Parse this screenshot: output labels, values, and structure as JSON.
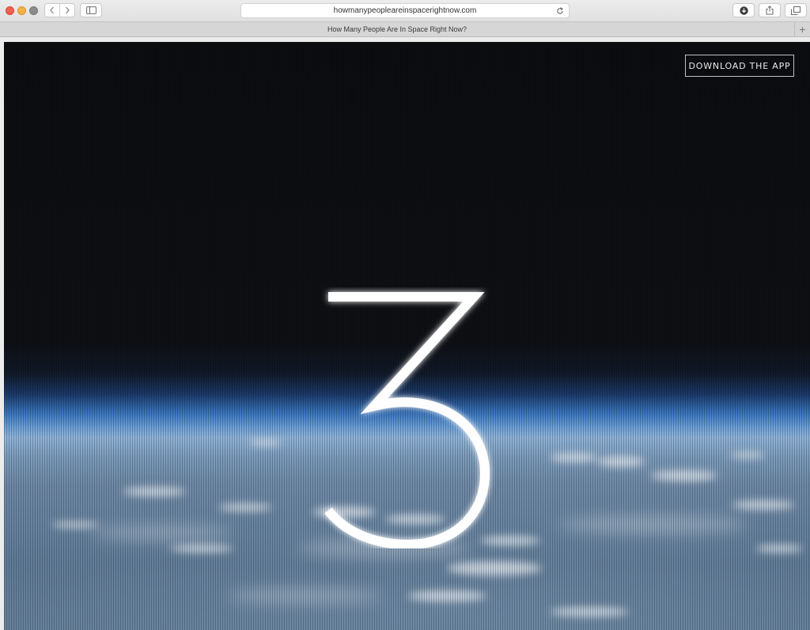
{
  "browser": {
    "url": "howmanypeopleareinspacerightnow.com",
    "tab_title": "How Many People Are In Space Right Now?",
    "new_tab_symbol": "+"
  },
  "page": {
    "download_label": "DOWNLOAD THE APP",
    "people_count": "3"
  },
  "icons": {
    "back": "chevron-left-icon",
    "forward": "chevron-right-icon",
    "sidebar": "sidebar-icon",
    "reload": "reload-icon",
    "downloads": "download-icon",
    "share": "share-icon",
    "tabs": "tabs-overview-icon"
  },
  "colors": {
    "close": "#f1604f",
    "minimize": "#f6b144",
    "zoom": "#8c8c8c",
    "space": "#0c0d10",
    "atmosphere": "#3c78c0"
  }
}
